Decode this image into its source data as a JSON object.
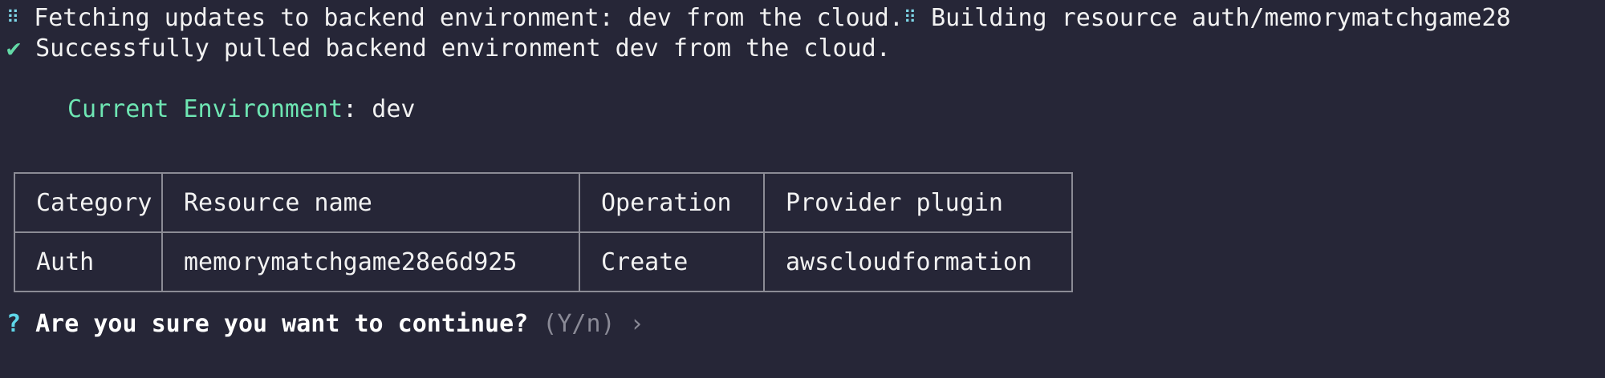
{
  "terminal": {
    "line1": {
      "spinner": "⠿",
      "text_a": "Fetching updates to backend environment: dev from the cloud.",
      "spinner2": "⠿",
      "text_b": "Building resource auth/memorymatchgame28"
    },
    "line2": {
      "check": "✔",
      "text": "Successfully pulled backend environment dev from the cloud."
    },
    "env": {
      "label": "Current Environment",
      "separator": ": ",
      "value": "dev"
    },
    "table": {
      "headers": [
        "Category",
        "Resource name",
        "Operation",
        "Provider plugin"
      ],
      "rows": [
        [
          "Auth",
          "memorymatchgame28e6d925",
          "Create",
          "awscloudformation"
        ]
      ]
    },
    "prompt": {
      "marker": "?",
      "question": "Are you sure you want to continue?",
      "hint": "(Y/n)",
      "arrow": "›"
    }
  },
  "colors": {
    "background": "#262637",
    "text": "#f2f2f2",
    "accent_green": "#6ee6b3",
    "accent_cyan": "#5fd6e8",
    "muted": "#8a8a96"
  }
}
